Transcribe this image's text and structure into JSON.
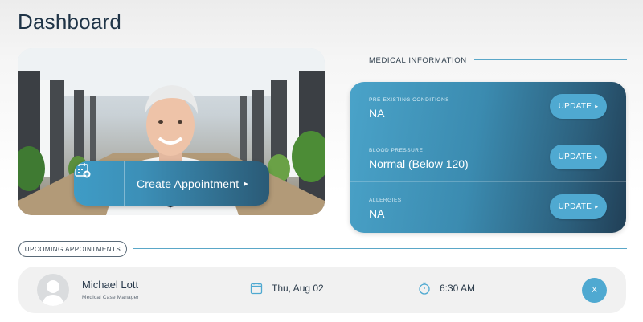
{
  "page": {
    "title": "Dashboard"
  },
  "hero": {
    "create_label": "Create Appointment",
    "arrow": "▶",
    "icon": "calendar-add-icon"
  },
  "medical": {
    "heading": "MEDICAL INFORMATION",
    "rows": [
      {
        "label": "PRE-EXISTING CONDITIONS",
        "value": "NA",
        "button": "UPDATE"
      },
      {
        "label": "BLOOD PRESSURE",
        "value": "Normal (Below 120)",
        "button": "UPDATE"
      },
      {
        "label": "ALLERGIES",
        "value": "NA",
        "button": "UPDATE"
      }
    ],
    "button_arrow": "▶"
  },
  "upcoming": {
    "heading": "UPCOMING APPOINTMENTS",
    "appointments": [
      {
        "name": "Michael Lott",
        "role": "Medical Case Manager",
        "date": "Thu, Aug 02",
        "time": "6:30 AM",
        "cancel": "X"
      }
    ]
  },
  "colors": {
    "accent": "#4fa9d1",
    "dark": "#213f56",
    "title": "#1f3447"
  }
}
